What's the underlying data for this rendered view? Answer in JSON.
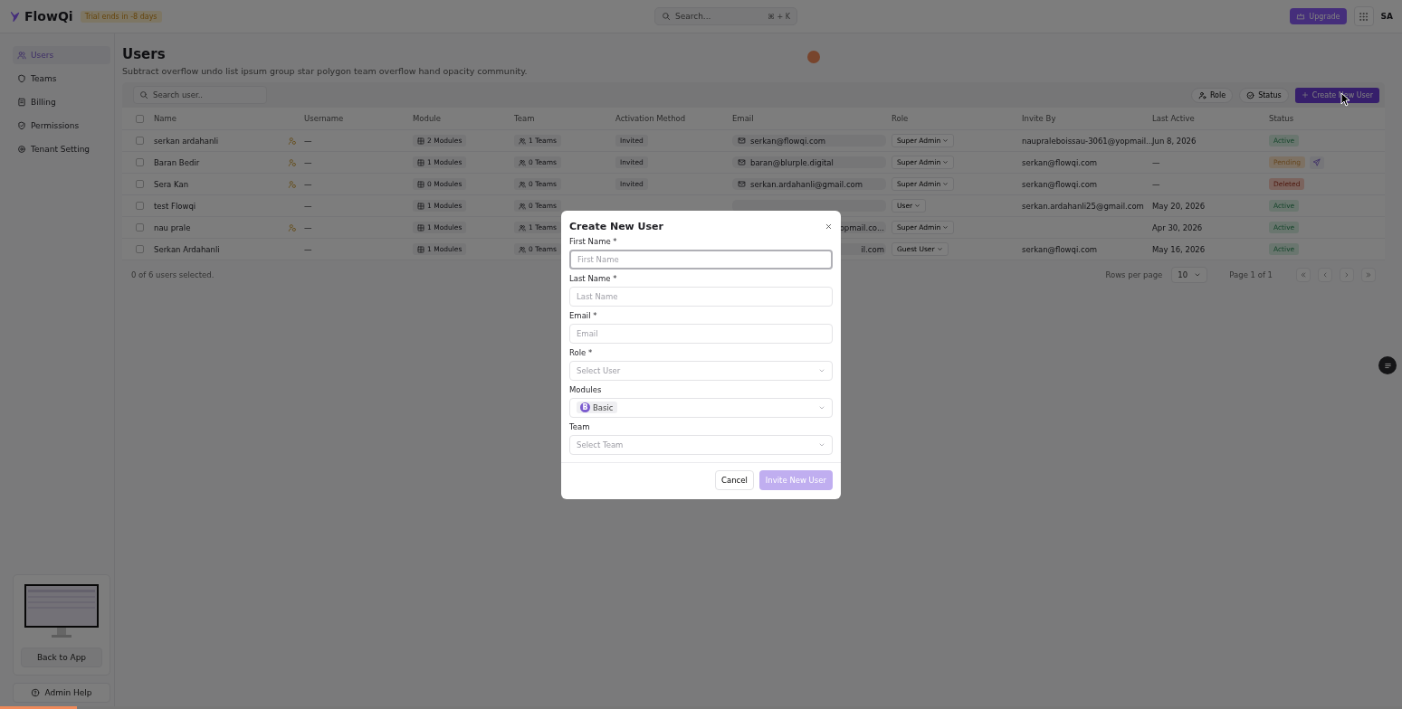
{
  "header": {
    "brand": "FlowQi",
    "trial": "Trial ends in -8 days",
    "search": {
      "placeholder": "Search...",
      "shortcut": "⌘ + K"
    },
    "upgrade": "Upgrade",
    "avatar": "SA"
  },
  "sidebar": {
    "items": [
      {
        "label": "Users",
        "selected": true
      },
      {
        "label": "Teams",
        "selected": false
      },
      {
        "label": "Billing",
        "selected": false
      },
      {
        "label": "Permissions",
        "selected": false
      },
      {
        "label": "Tenant Setting",
        "selected": false
      }
    ],
    "back": "Back to App",
    "help": "Admin Help"
  },
  "page": {
    "title": "Users",
    "subtitle": "Subtract overflow undo list ipsum group star polygon team overflow hand opacity community."
  },
  "toolbar": {
    "search": {
      "placeholder": "Search user.."
    },
    "filters": [
      "Role",
      "Status"
    ],
    "create": "Create New User"
  },
  "table": {
    "select_all": false,
    "columns": [
      "Name",
      "Username",
      "Module",
      "Team",
      "Activation Method",
      "Email",
      "Role",
      "Invite By",
      "Last Active",
      "Status"
    ],
    "rows": [
      {
        "name": "serkan ardahanli",
        "flag": true,
        "username": "—",
        "module": "2 Modules",
        "team": "1 Teams",
        "activation": "Invited",
        "email": "serkan@flowqi.com",
        "email_covered": false,
        "role": "Super Admin",
        "invite_by": "naupraleboissau-3061@yopmail...",
        "last_active": "Jun 8, 2026",
        "status": {
          "label": "Active",
          "kind": "active"
        },
        "resend": false,
        "checked": false
      },
      {
        "name": "Baran Bedir",
        "flag": true,
        "username": "—",
        "module": "1 Modules",
        "team": "0 Teams",
        "activation": "Invited",
        "email": "baran@blurple.digital",
        "email_covered": false,
        "role": "Super Admin",
        "invite_by": "serkan@flowqi.com",
        "last_active": "—",
        "status": {
          "label": "Pending",
          "kind": "pending"
        },
        "resend": true,
        "checked": false
      },
      {
        "name": "Sera Kan",
        "flag": true,
        "username": "—",
        "module": "0 Modules",
        "team": "0 Teams",
        "activation": "Invited",
        "email": "serkan.ardahanli@gmail.com",
        "email_covered": false,
        "role": "Super Admin",
        "invite_by": "serkan@flowqi.com",
        "last_active": "—",
        "status": {
          "label": "Deleted",
          "kind": "deleted"
        },
        "resend": false,
        "checked": false
      },
      {
        "name": "test Flowqi",
        "flag": false,
        "username": "—",
        "module": "1 Modules",
        "team": "0 Teams",
        "email_covered": true,
        "role": "User",
        "invite_by": "serkan.ardahanli25@gmail.com",
        "last_active": "May 20, 2026",
        "status": {
          "label": "Active",
          "kind": "active"
        },
        "resend": false,
        "checked": false
      },
      {
        "name": "nau prale",
        "flag": true,
        "username": "—",
        "module": "1 Modules",
        "team": "1 Teams",
        "email": "opmail.co...",
        "email_covered": true,
        "role": "Super Admin",
        "last_active": "Apr 30, 2026",
        "status": {
          "label": "Active",
          "kind": "active"
        },
        "resend": false,
        "checked": false
      },
      {
        "name": "Serkan Ardahanli",
        "flag": false,
        "username": "—",
        "module": "1 Modules",
        "team": "0 Teams",
        "email": "il.com",
        "email_covered": true,
        "role": "Guest User",
        "invite_by": "serkan@flowqi.com",
        "last_active": "May 16, 2026",
        "status": {
          "label": "Active",
          "kind": "active"
        },
        "resend": false,
        "checked": false
      }
    ]
  },
  "footer": {
    "selected": "0 of 6 users selected.",
    "rows_label": "Rows per page",
    "rows_value": "10",
    "page": "Page 1 of 1"
  },
  "dialog": {
    "title": "Create New User",
    "fields": [
      {
        "label": "First Name *",
        "kind": "text",
        "placeholder": "First Name",
        "focused": true
      },
      {
        "label": "Last Name *",
        "kind": "text",
        "placeholder": "Last Name",
        "focused": false
      },
      {
        "label": "Email *",
        "kind": "text",
        "placeholder": "Email",
        "focused": false
      },
      {
        "label": "Role *",
        "kind": "select",
        "placeholder": "Select User",
        "focused": false
      },
      {
        "label": "Modules",
        "kind": "chips",
        "chips": [
          {
            "letter": "B",
            "label": "Basic"
          }
        ],
        "focused": false
      },
      {
        "label": "Team",
        "kind": "select",
        "placeholder": "Select Team",
        "focused": false
      }
    ],
    "cancel": "Cancel",
    "submit": "Invite New User",
    "submit_disabled": true
  },
  "recording": {
    "level": 0.055
  }
}
